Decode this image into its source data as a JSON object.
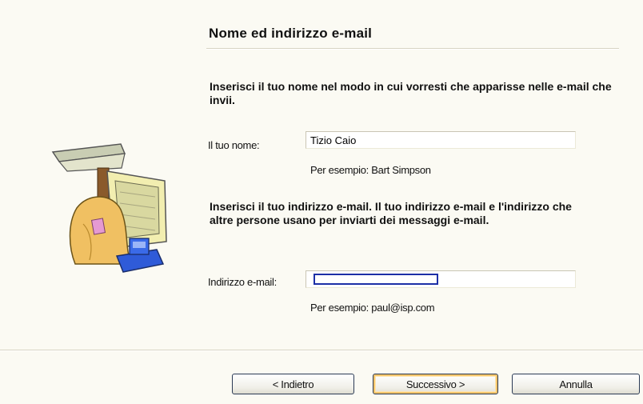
{
  "page": {
    "title": "Nome ed indirizzo e-mail",
    "name_instruction": "Inserisci il tuo nome nel modo in cui vorresti che apparisse nelle e-mail che invii.",
    "name_label": "Il tuo nome:",
    "name_value": "Tizio Caio",
    "name_example": "Per esempio: Bart Simpson",
    "email_instruction": "Inserisci il tuo indirizzo e-mail. Il tuo indirizzo e-mail e l'indirizzo che altre persone usano per inviarti dei messaggi e-mail.",
    "email_label": "Indirizzo e-mail:",
    "email_value": "",
    "email_example": "Per esempio: paul@isp.com"
  },
  "buttons": {
    "back": "< Indietro",
    "next": "Successivo >",
    "cancel": "Annulla"
  },
  "icons": {
    "illustration": "computer-mail-wizard-icon"
  },
  "colors": {
    "background": "#fbfaf3",
    "focus_border": "#1c2fa6",
    "default_button_highlight": "#f5c56a"
  }
}
